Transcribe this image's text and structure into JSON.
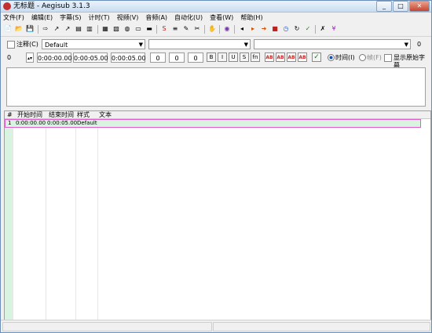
{
  "window": {
    "title": "无标题 - Aegisub 3.1.3",
    "min": "_",
    "max": "□",
    "close": "✕"
  },
  "menus": [
    "文件(F)",
    "编辑(E)",
    "字幕(S)",
    "计时(T)",
    "视频(V)",
    "音频(A)",
    "自动化(U)",
    "查看(W)",
    "帮助(H)"
  ],
  "toolbar_icons": [
    {
      "name": "new-file-icon",
      "glyph": "📄"
    },
    {
      "name": "open-file-icon",
      "glyph": "📂"
    },
    {
      "name": "save-icon",
      "glyph": "💾"
    },
    {
      "name": "jump-icon",
      "glyph": "⇨"
    },
    {
      "name": "pin-icon",
      "glyph": "↗"
    },
    {
      "name": "pin2-icon",
      "glyph": "↗"
    },
    {
      "name": "doc-icon",
      "glyph": "▤"
    },
    {
      "name": "doc2-icon",
      "glyph": "▥"
    },
    {
      "name": "props-icon",
      "glyph": "▦"
    },
    {
      "name": "props2-icon",
      "glyph": "▧"
    },
    {
      "name": "globe-icon",
      "glyph": "◍"
    },
    {
      "name": "video-icon",
      "glyph": "▭"
    },
    {
      "name": "film-icon",
      "glyph": "▬"
    },
    {
      "name": "spell-icon",
      "glyph": "S"
    },
    {
      "name": "notes-icon",
      "glyph": "≡"
    },
    {
      "name": "pencil-icon",
      "glyph": "✎"
    },
    {
      "name": "scissor-icon",
      "glyph": "✂"
    },
    {
      "name": "hand-icon",
      "glyph": "✋"
    },
    {
      "name": "ball-icon",
      "glyph": "◉"
    },
    {
      "name": "prev-icon",
      "glyph": "◂"
    },
    {
      "name": "next-icon",
      "glyph": "▸"
    },
    {
      "name": "arrow-icon",
      "glyph": "➜"
    },
    {
      "name": "stop-icon",
      "glyph": "■"
    },
    {
      "name": "clock-icon",
      "glyph": "◷"
    },
    {
      "name": "refresh-icon",
      "glyph": "↻"
    },
    {
      "name": "check-icon",
      "glyph": "✓"
    },
    {
      "name": "tool-icon",
      "glyph": "✗"
    },
    {
      "name": "style-icon",
      "glyph": "¥"
    }
  ],
  "edit": {
    "comment_label": "注释(C)",
    "style_value": "Default",
    "actor_value": "",
    "effect_value": "",
    "layer_value": "0",
    "margin_right_value": "0",
    "layer_spin": "0",
    "start_time": "0:00:00.00",
    "end_time": "0:00:05.00",
    "duration": "0:00:05.00",
    "margin_l": "0",
    "margin_r": "0",
    "margin_v": "0",
    "fmt_buttons": [
      "B",
      "I",
      "U",
      "S",
      "fn"
    ],
    "color_buttons": [
      "AB",
      "AB",
      "AB",
      "AB"
    ],
    "commit_glyph": "✓",
    "time_label": "时间(I)",
    "frame_label": "帧(F)",
    "show_original_label": "显示原始字幕"
  },
  "grid": {
    "headers": [
      "#",
      "开始时间",
      "结束时间",
      "样式",
      "文本"
    ],
    "rows": [
      {
        "num": "1",
        "start": "0:00:00.00",
        "end": "0:00:05.00",
        "style": "Default",
        "text": ""
      }
    ]
  }
}
